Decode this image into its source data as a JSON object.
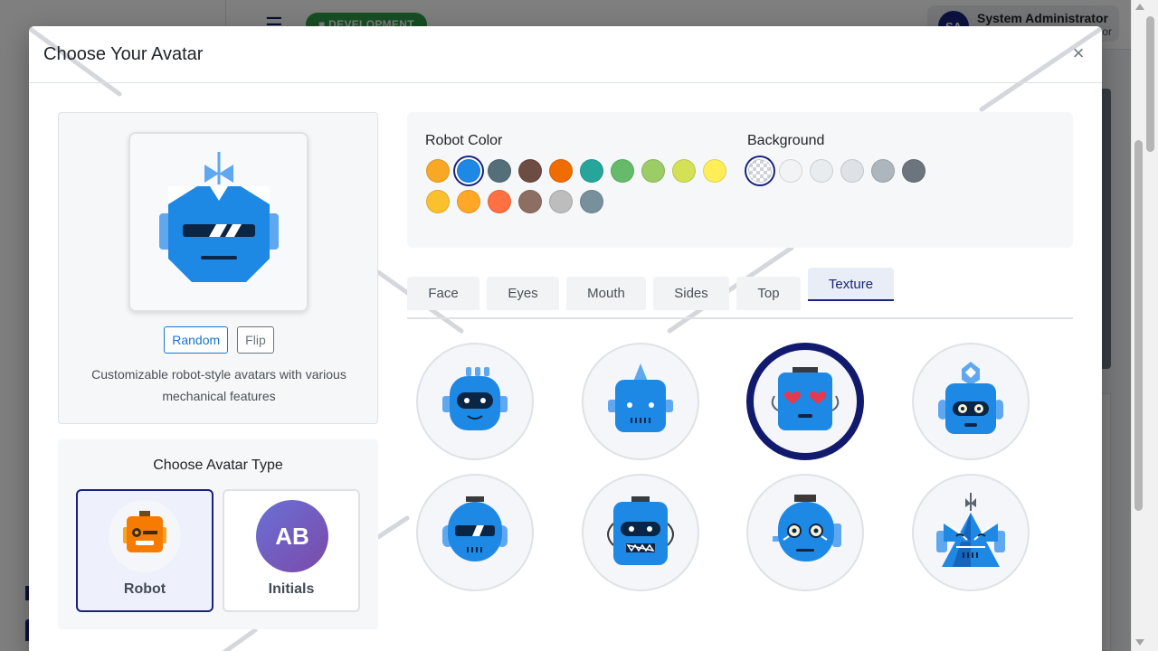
{
  "background_app": {
    "env_badge": "■ DEVELOPMENT",
    "user_initials": "SA",
    "user_name": "System Administrator",
    "user_role": "or"
  },
  "modal": {
    "title": "Choose Your Avatar",
    "close_icon": "close-icon",
    "close_glyph": "×"
  },
  "preview": {
    "random_label": "Random",
    "flip_label": "Flip",
    "description": "Customizable robot-style avatars with various mechanical features"
  },
  "avatar_type": {
    "title": "Choose Avatar Type",
    "options": [
      {
        "label": "Robot",
        "selected": true
      },
      {
        "label": "Initials",
        "initials": "AB",
        "selected": false
      }
    ]
  },
  "robot_color": {
    "label": "Robot Color",
    "swatches": [
      "#f9a825",
      "#1e88e5",
      "#546e7a",
      "#6d4c41",
      "#ef6c00",
      "#26a69a",
      "#66bb6a",
      "#9ccc65",
      "#d4e157",
      "#ffee58",
      "#fbc02d",
      "#ffa726",
      "#ff7043",
      "#8d6e63",
      "#bdbdbd",
      "#78909c"
    ],
    "selected_index": 1
  },
  "background": {
    "label": "Background",
    "swatches": [
      "transparent",
      "#f1f3f5",
      "#e9ecef",
      "#dee2e6",
      "#adb5bd",
      "#6c757d"
    ],
    "selected_index": 0
  },
  "tabs": {
    "items": [
      "Face",
      "Eyes",
      "Mouth",
      "Sides",
      "Top",
      "Texture"
    ],
    "active_index": 5
  },
  "texture_options": {
    "count": 8,
    "selected_index": 2
  },
  "colors": {
    "accent": "#1a237e",
    "robot_blue": "#1e88e5",
    "env_green": "#2e9e49"
  }
}
